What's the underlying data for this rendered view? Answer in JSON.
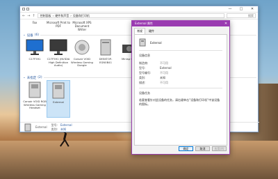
{
  "explorer": {
    "window_controls": [
      "—",
      "□",
      "✕"
    ],
    "address": {
      "crumbs": [
        "控制面板",
        "硬件和声音",
        "设备和打印机"
      ],
      "search_placeholder": "搜索"
    },
    "top_items": [
      {
        "label": "Fax"
      },
      {
        "label": "Microsoft Print to PDF"
      },
      {
        "label": "Microsoft XPS Document Writer"
      }
    ],
    "devices_section": {
      "title": "设备",
      "count": "(6)"
    },
    "devices": [
      {
        "label": "C27F591",
        "icon": "monitor-icon"
      },
      {
        "label": "C27F591 (NVIDIA High Definition Audio)",
        "icon": "speaker-monitor-icon"
      },
      {
        "label": "Corsair VOID Wireless Gaming Dongle",
        "icon": "dongle-icon"
      },
      {
        "label": "DESKTOP-EGN0B41",
        "icon": "pc-tower-icon"
      },
      {
        "label": "Minisp Cam",
        "icon": "camera-icon"
      }
    ],
    "unspecified_section": {
      "title": "未指定",
      "count": "(2)"
    },
    "unspecified": [
      {
        "label": "Corsair VOID RGB Wireless Gaming Headset",
        "icon": "headset-box-icon"
      },
      {
        "label": "External",
        "icon": "drive-box-icon"
      }
    ],
    "status": {
      "name": "External",
      "k1": "型号:",
      "v1": "External",
      "k2": "类别:",
      "v2": "未知"
    }
  },
  "dialog": {
    "title": "External 属性",
    "close": "✕",
    "tabs": [
      "常规",
      "硬件"
    ],
    "device_name": "External",
    "info_group": "设备信息",
    "props": [
      {
        "k": "制造商:",
        "v": "不可用"
      },
      {
        "k": "型号:",
        "v": "External"
      },
      {
        "k": "型号编号:",
        "v": "不可用"
      },
      {
        "k": "类别:",
        "v": "未知"
      },
      {
        "k": "描述:",
        "v": "不可用"
      }
    ],
    "status_group": "设备任务",
    "status_text": "若要查看针对此设备的任务，请右键单击“设备和打印机”中该设备的图标。",
    "buttons": {
      "ok": "确定",
      "cancel": "取消",
      "apply": "应用(A)"
    }
  }
}
